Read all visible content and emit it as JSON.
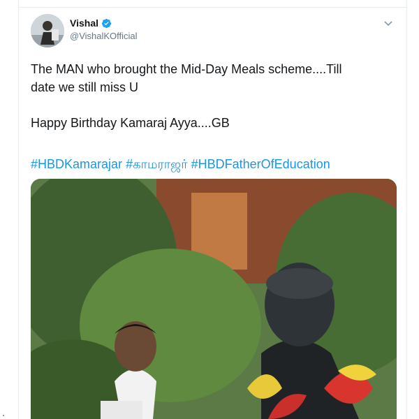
{
  "tweet": {
    "author": {
      "display_name": "Vishal",
      "handle": "@VishalKOfficial",
      "verified": true
    },
    "text_line1": "The MAN who brought the Mid-Day Meals scheme....Till",
    "text_line2": "date we still miss U",
    "text_line3": "Happy Birthday Kamaraj Ayya....GB",
    "hashtags": [
      "#HBDKamarajar",
      "#காமராஜர்",
      "#HBDFatherOfEducation"
    ],
    "colors": {
      "link": "#1b95e0",
      "verified": "#1da1f2",
      "text": "#14171a",
      "secondary": "#657786"
    },
    "icons": {
      "menu": "chevron-down-icon",
      "verified": "verified-badge-icon"
    }
  }
}
